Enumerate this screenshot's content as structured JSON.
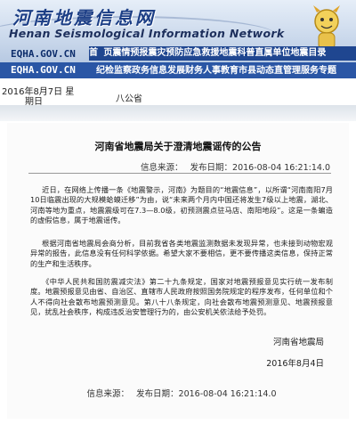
{
  "site": {
    "title_cn": "河南地震信息网",
    "title_en": "Henan Seismological Information Network",
    "domain": "EQHA.GOV.CN"
  },
  "nav": {
    "row1": [
      "首",
      "页",
      "震情预报",
      "震灾预防",
      "应急救援",
      "地震科普",
      "直属单位",
      "地震目录"
    ],
    "row2_domain": "EQHA.GOV.CN",
    "row2": [
      "纪检监察",
      "政务信息",
      "发展财务",
      "人事教育",
      "市县动态",
      "直管理服务",
      "专题"
    ]
  },
  "datebar": {
    "date": "2016年8月7日",
    "weekday_prefix": "星",
    "weekday_suffix": "期日",
    "holiday": "八公省"
  },
  "article": {
    "title": "河南省地震局关于澄清地震谣传的公告",
    "source_label": "信息来源：",
    "publish_label": "发布日期：",
    "publish_date": "2016-08-04 16:21:14.0",
    "p1": "近日，在网络上传播一条《地震警示，河南》为题目的“地震信息”，以所谓“河南南阳7月10日临震出现的大规模蛤蟆迁移”为由，说“未来两个月内中国还将发生7级以上地震，湖北、河南等地为重点，地震震级可在7.3—8.0级，初预测震点驻马店、南阳地段”。这是一条蝙造的虚假信息，属于地震谣传。",
    "p2": "根据河南省地震局会商分析，目前我省各类地震监测数据未发现异常，也未接到动物宏观异常的报告，此信息没有任何科学依据。希望大家不要相信，更不要传播这类信息，保持正常的生产和生活秩序。",
    "p3": "《中华人民共和国防震减灾法》第二十九条规定，国家对地震预报意见实行统一发布制度。地震预报意见由省、自治区、直辖市人民政府按照国务院规定的程序发布，任何单位和个人不得向社会散布地震预测意见。第八十八条规定，向社会散布地震预测意见、地震预报意见，扰乱社会秩序，构成违反治安管理行为的，由公安机关依法给予处罚。",
    "sign_org": "河南省地震局",
    "sign_date": "2016年8月4日"
  },
  "colors": {
    "nav_dark": "#1a3a78",
    "nav_light": "#2a56a5",
    "banner_text": "#1d3f86"
  }
}
